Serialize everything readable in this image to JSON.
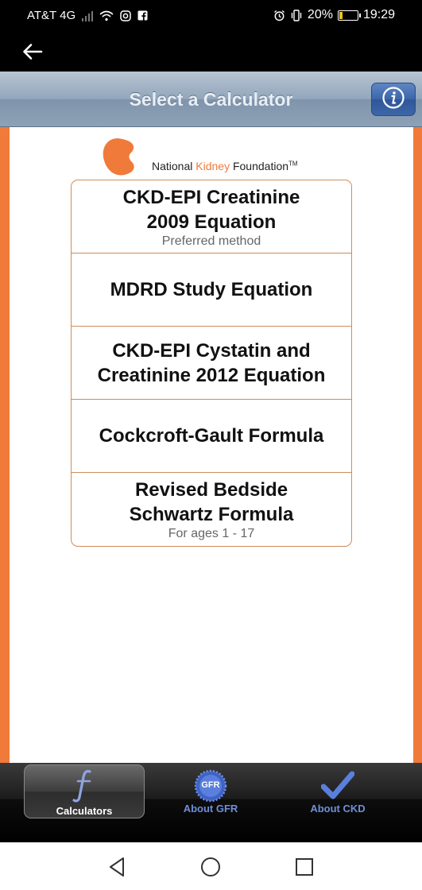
{
  "status_bar": {
    "carrier": "AT&T 4G",
    "battery_percent": "20%",
    "battery_level": 0.2,
    "time": "19:29",
    "icons": [
      "signal-bars-icon",
      "wifi-icon",
      "instagram-icon",
      "facebook-icon",
      "alarm-icon",
      "vibrate-icon",
      "battery-icon"
    ]
  },
  "header": {
    "title": "Select a Calculator",
    "info_icon": "info-icon"
  },
  "logo": {
    "prefix": "National ",
    "highlight": "Kidney",
    "suffix": " Foundation",
    "trademark": "TM"
  },
  "calculators": [
    {
      "title": "CKD-EPI Creatinine\n2009 Equation",
      "subtitle": "Preferred method"
    },
    {
      "title": "MDRD Study Equation",
      "subtitle": ""
    },
    {
      "title": "CKD-EPI Cystatin and\nCreatinine 2012 Equation",
      "subtitle": ""
    },
    {
      "title": "Cockcroft-Gault Formula",
      "subtitle": ""
    },
    {
      "title": "Revised Bedside\nSchwartz Formula",
      "subtitle": "For ages 1 - 17"
    }
  ],
  "tabs": [
    {
      "label": "Calculators",
      "icon": "function-icon",
      "selected": true
    },
    {
      "label": "About GFR",
      "icon": "gfr-badge-icon",
      "badge": "GFR",
      "selected": false
    },
    {
      "label": "About CKD",
      "icon": "checkmark-icon",
      "selected": false
    }
  ],
  "colors": {
    "brand_orange": "#f07a3a",
    "header_blue_gray": "#93a6bb",
    "info_blue": "#3c66aa",
    "tab_inactive_blue": "#6f8fd9"
  }
}
